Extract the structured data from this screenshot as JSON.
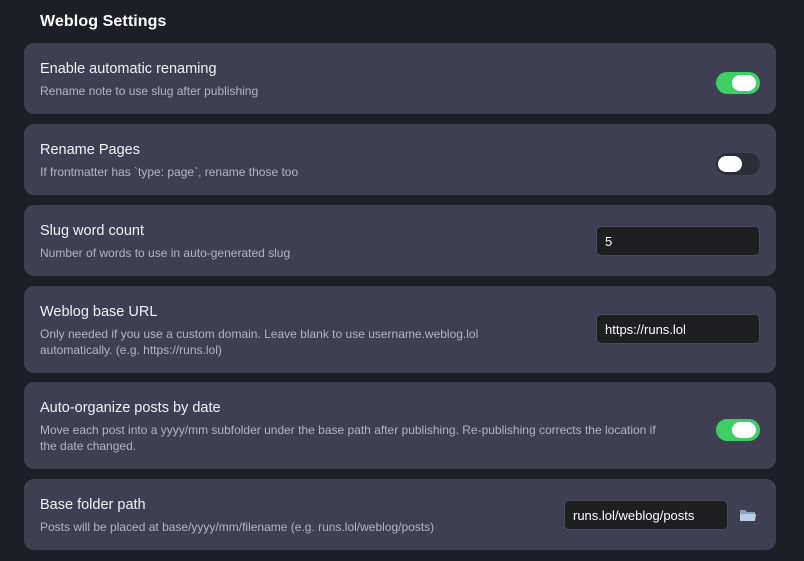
{
  "section": {
    "title": "Weblog Settings"
  },
  "settings": [
    {
      "name": "Enable automatic renaming",
      "desc": "Rename note to use slug after publishing",
      "control": "toggle",
      "enabled": true
    },
    {
      "name": "Rename Pages",
      "desc": "If frontmatter has `type: page`, rename those too",
      "control": "toggle",
      "enabled": false
    },
    {
      "name": "Slug word count",
      "desc": "Number of words to use in auto-generated slug",
      "control": "text",
      "value": "5"
    },
    {
      "name": "Weblog base URL",
      "desc_line1": "Only needed if you use a custom domain. Leave blank to use username.weblog.lol",
      "desc_line2": "automatically. (e.g. https://runs.lol)",
      "control": "text",
      "value": "https://runs.lol"
    },
    {
      "name": "Auto-organize posts by date",
      "desc_line1": "Move each post into a yyyy/mm subfolder under the base path after publishing. Re-publishing corrects the location if",
      "desc_line2": "the date changed.",
      "control": "toggle",
      "enabled": true
    },
    {
      "name": "Base folder path",
      "desc": "Posts will be placed at base/yyyy/mm/filename (e.g. runs.lol/weblog/posts)",
      "control": "text",
      "value": "runs.lol/weblog/posts",
      "extra_icon": "folder-icon"
    }
  ],
  "colors": {
    "background": "#1e1e26",
    "card": "#3f3f53",
    "toggle_on": "#3ecf64",
    "toggle_off": "#2d2d3a"
  }
}
